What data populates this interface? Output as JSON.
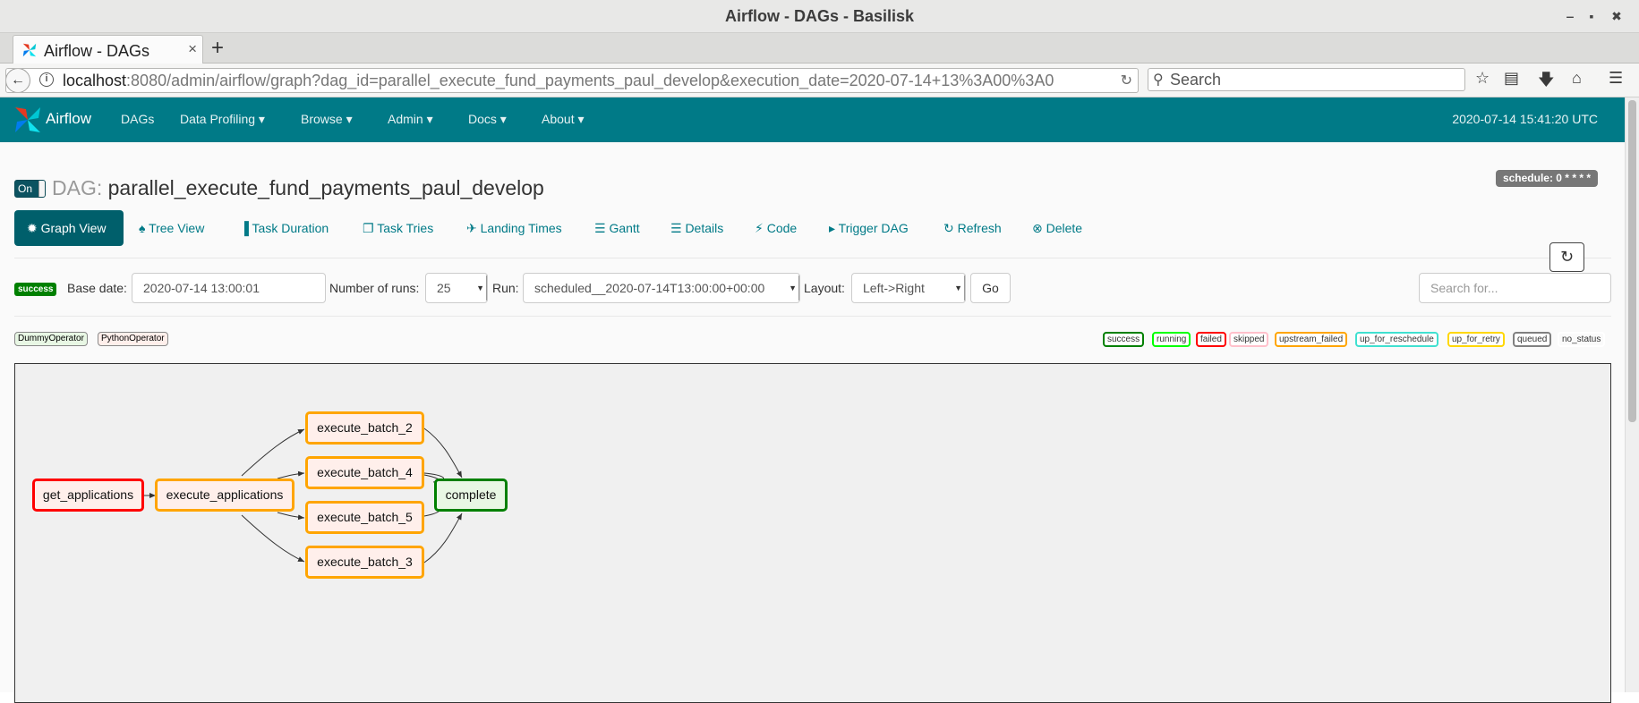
{
  "window": {
    "title": "Airflow - DAGs - Basilisk",
    "minimize": "‒",
    "maximize": "▪",
    "close": "✖"
  },
  "browser": {
    "tab_title": "Airflow - DAGs",
    "tab_close": "×",
    "new_tab": "+",
    "url_host": "localhost",
    "url_path": ":8080/admin/airflow/graph?dag_id=parallel_execute_fund_payments_paul_develop&execution_date=2020-07-14+13%3A00%3A0",
    "search_placeholder": "Search"
  },
  "airflow_nav": {
    "brand": "Airflow",
    "menu": [
      "DAGs",
      "Data Profiling ▾",
      "Browse ▾",
      "Admin ▾",
      "Docs ▾",
      "About ▾"
    ],
    "clock": "2020-07-14 15:41:20 UTC"
  },
  "dag": {
    "toggle_label": "On",
    "title_prefix": "DAG:",
    "dag_id": "parallel_execute_fund_payments_paul_develop",
    "schedule": "schedule: 0 * * * *"
  },
  "view_tabs": [
    {
      "label": "✹ Graph View",
      "active": true
    },
    {
      "label": "♠ Tree View"
    },
    {
      "label": "▐ Task Duration"
    },
    {
      "label": "❐ Task Tries"
    },
    {
      "label": "✈ Landing Times"
    },
    {
      "label": "☰ Gantt"
    },
    {
      "label": "☰ Details"
    },
    {
      "label": "⚡ Code"
    },
    {
      "label": "▸ Trigger DAG"
    },
    {
      "label": "↻ Refresh"
    },
    {
      "label": "⊗ Delete"
    }
  ],
  "form": {
    "state_badge": "success",
    "base_date_label": "Base date:",
    "base_date_value": "2020-07-14 13:00:01",
    "num_runs_label": "Number of runs:",
    "num_runs_value": "25",
    "run_label": "Run:",
    "run_value": "scheduled__2020-07-14T13:00:00+00:00",
    "layout_label": "Layout:",
    "layout_value": "Left->Right",
    "go_label": "Go",
    "search_placeholder": "Search for..."
  },
  "operators": [
    "DummyOperator",
    "PythonOperator"
  ],
  "operator_colors": [
    "#e8f7e4",
    "#ffefeb"
  ],
  "states": [
    {
      "label": "success",
      "color": "#008000"
    },
    {
      "label": "running",
      "color": "#00ff00"
    },
    {
      "label": "failed",
      "color": "#ff0000"
    },
    {
      "label": "skipped",
      "color": "#ffc0cb"
    },
    {
      "label": "upstream_failed",
      "color": "#ffa500"
    },
    {
      "label": "up_for_reschedule",
      "color": "#40e0d0"
    },
    {
      "label": "up_for_retry",
      "color": "#ffd700"
    },
    {
      "label": "queued",
      "color": "#808080"
    },
    {
      "label": "no_status",
      "color": "#ffffff"
    }
  ],
  "graph": {
    "refresh_icon": "↻",
    "nodes": [
      {
        "id": "get_applications",
        "state_color": "#ff0000",
        "fill": "#ffefeb"
      },
      {
        "id": "execute_applications",
        "state_color": "#ffa500",
        "fill": "#ffefeb"
      },
      {
        "id": "execute_batch_2",
        "state_color": "#ffa500",
        "fill": "#ffefeb"
      },
      {
        "id": "execute_batch_4",
        "state_color": "#ffa500",
        "fill": "#ffefeb"
      },
      {
        "id": "execute_batch_5",
        "state_color": "#ffa500",
        "fill": "#ffefeb"
      },
      {
        "id": "execute_batch_3",
        "state_color": "#ffa500",
        "fill": "#ffefeb"
      },
      {
        "id": "complete",
        "state_color": "#008000",
        "fill": "#e8f7e4"
      }
    ]
  }
}
